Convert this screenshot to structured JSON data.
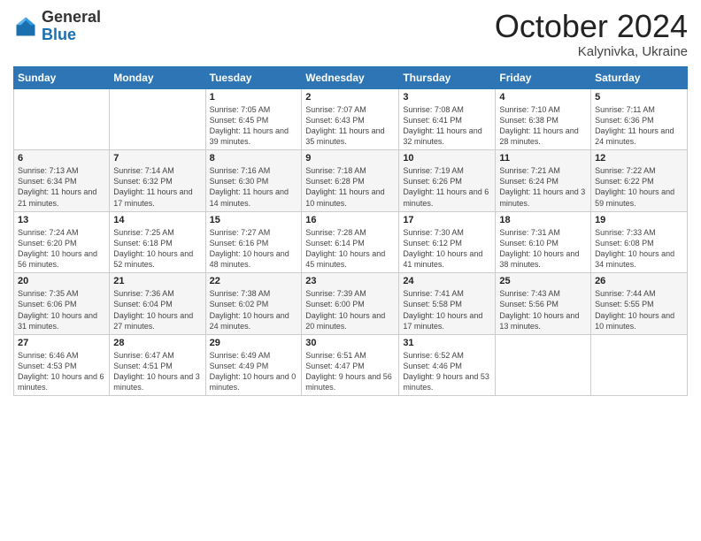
{
  "logo": {
    "general": "General",
    "blue": "Blue"
  },
  "header": {
    "month": "October 2024",
    "location": "Kalynivka, Ukraine"
  },
  "weekdays": [
    "Sunday",
    "Monday",
    "Tuesday",
    "Wednesday",
    "Thursday",
    "Friday",
    "Saturday"
  ],
  "weeks": [
    [
      {
        "day": "",
        "info": ""
      },
      {
        "day": "",
        "info": ""
      },
      {
        "day": "1",
        "info": "Sunrise: 7:05 AM\nSunset: 6:45 PM\nDaylight: 11 hours and 39 minutes."
      },
      {
        "day": "2",
        "info": "Sunrise: 7:07 AM\nSunset: 6:43 PM\nDaylight: 11 hours and 35 minutes."
      },
      {
        "day": "3",
        "info": "Sunrise: 7:08 AM\nSunset: 6:41 PM\nDaylight: 11 hours and 32 minutes."
      },
      {
        "day": "4",
        "info": "Sunrise: 7:10 AM\nSunset: 6:38 PM\nDaylight: 11 hours and 28 minutes."
      },
      {
        "day": "5",
        "info": "Sunrise: 7:11 AM\nSunset: 6:36 PM\nDaylight: 11 hours and 24 minutes."
      }
    ],
    [
      {
        "day": "6",
        "info": "Sunrise: 7:13 AM\nSunset: 6:34 PM\nDaylight: 11 hours and 21 minutes."
      },
      {
        "day": "7",
        "info": "Sunrise: 7:14 AM\nSunset: 6:32 PM\nDaylight: 11 hours and 17 minutes."
      },
      {
        "day": "8",
        "info": "Sunrise: 7:16 AM\nSunset: 6:30 PM\nDaylight: 11 hours and 14 minutes."
      },
      {
        "day": "9",
        "info": "Sunrise: 7:18 AM\nSunset: 6:28 PM\nDaylight: 11 hours and 10 minutes."
      },
      {
        "day": "10",
        "info": "Sunrise: 7:19 AM\nSunset: 6:26 PM\nDaylight: 11 hours and 6 minutes."
      },
      {
        "day": "11",
        "info": "Sunrise: 7:21 AM\nSunset: 6:24 PM\nDaylight: 11 hours and 3 minutes."
      },
      {
        "day": "12",
        "info": "Sunrise: 7:22 AM\nSunset: 6:22 PM\nDaylight: 10 hours and 59 minutes."
      }
    ],
    [
      {
        "day": "13",
        "info": "Sunrise: 7:24 AM\nSunset: 6:20 PM\nDaylight: 10 hours and 56 minutes."
      },
      {
        "day": "14",
        "info": "Sunrise: 7:25 AM\nSunset: 6:18 PM\nDaylight: 10 hours and 52 minutes."
      },
      {
        "day": "15",
        "info": "Sunrise: 7:27 AM\nSunset: 6:16 PM\nDaylight: 10 hours and 48 minutes."
      },
      {
        "day": "16",
        "info": "Sunrise: 7:28 AM\nSunset: 6:14 PM\nDaylight: 10 hours and 45 minutes."
      },
      {
        "day": "17",
        "info": "Sunrise: 7:30 AM\nSunset: 6:12 PM\nDaylight: 10 hours and 41 minutes."
      },
      {
        "day": "18",
        "info": "Sunrise: 7:31 AM\nSunset: 6:10 PM\nDaylight: 10 hours and 38 minutes."
      },
      {
        "day": "19",
        "info": "Sunrise: 7:33 AM\nSunset: 6:08 PM\nDaylight: 10 hours and 34 minutes."
      }
    ],
    [
      {
        "day": "20",
        "info": "Sunrise: 7:35 AM\nSunset: 6:06 PM\nDaylight: 10 hours and 31 minutes."
      },
      {
        "day": "21",
        "info": "Sunrise: 7:36 AM\nSunset: 6:04 PM\nDaylight: 10 hours and 27 minutes."
      },
      {
        "day": "22",
        "info": "Sunrise: 7:38 AM\nSunset: 6:02 PM\nDaylight: 10 hours and 24 minutes."
      },
      {
        "day": "23",
        "info": "Sunrise: 7:39 AM\nSunset: 6:00 PM\nDaylight: 10 hours and 20 minutes."
      },
      {
        "day": "24",
        "info": "Sunrise: 7:41 AM\nSunset: 5:58 PM\nDaylight: 10 hours and 17 minutes."
      },
      {
        "day": "25",
        "info": "Sunrise: 7:43 AM\nSunset: 5:56 PM\nDaylight: 10 hours and 13 minutes."
      },
      {
        "day": "26",
        "info": "Sunrise: 7:44 AM\nSunset: 5:55 PM\nDaylight: 10 hours and 10 minutes."
      }
    ],
    [
      {
        "day": "27",
        "info": "Sunrise: 6:46 AM\nSunset: 4:53 PM\nDaylight: 10 hours and 6 minutes."
      },
      {
        "day": "28",
        "info": "Sunrise: 6:47 AM\nSunset: 4:51 PM\nDaylight: 10 hours and 3 minutes."
      },
      {
        "day": "29",
        "info": "Sunrise: 6:49 AM\nSunset: 4:49 PM\nDaylight: 10 hours and 0 minutes."
      },
      {
        "day": "30",
        "info": "Sunrise: 6:51 AM\nSunset: 4:47 PM\nDaylight: 9 hours and 56 minutes."
      },
      {
        "day": "31",
        "info": "Sunrise: 6:52 AM\nSunset: 4:46 PM\nDaylight: 9 hours and 53 minutes."
      },
      {
        "day": "",
        "info": ""
      },
      {
        "day": "",
        "info": ""
      }
    ]
  ]
}
